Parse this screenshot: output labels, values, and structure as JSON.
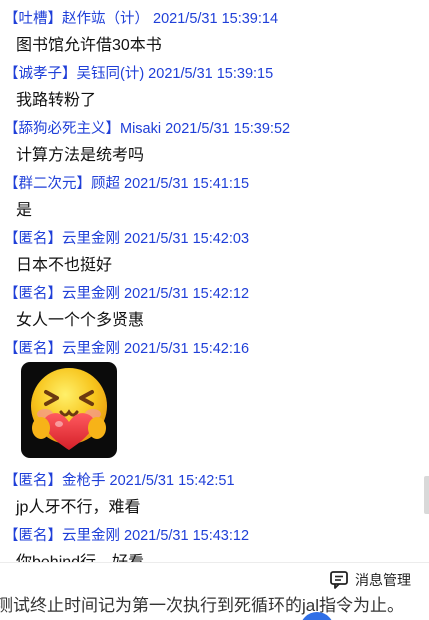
{
  "messages": [
    {
      "header": "【吐槽】赵作竑（计） 2021/5/31 15:39:14",
      "text": "图书馆允许借30本书"
    },
    {
      "header": "【诚孝子】吴钰同(计) 2021/5/31 15:39:15",
      "text": "我路转粉了"
    },
    {
      "header": "【舔狗必死主义】Misaki 2021/5/31 15:39:52",
      "text": "计算方法是统考吗"
    },
    {
      "header": "【群二次元】顾超 2021/5/31 15:41:15",
      "text": "是"
    },
    {
      "header": "【匿名】云里金刚 2021/5/31 15:42:03",
      "text": "日本不也挺好"
    },
    {
      "header": "【匿名】云里金刚 2021/5/31 15:42:12",
      "text": "女人一个个多贤惠"
    },
    {
      "header": "【匿名】云里金刚 2021/5/31 15:42:16",
      "sticker": "heart-hug-emoji"
    },
    {
      "header": "【匿名】金枪手 2021/5/31 15:42:51",
      "text": "jp人牙不行，难看"
    },
    {
      "header": "【匿名】云里金刚 2021/5/31 15:43:12",
      "text": "你behind行，好看"
    }
  ],
  "footer": {
    "manage_label": "消息管理",
    "manage_icon": "message-manage-icon"
  },
  "bottom_note": "测试终止时间记为第一次执行到死循环的jal指令为止。",
  "colors": {
    "header_blue": "#1f3fd8",
    "sticker_bg": "#0b0b0b",
    "emoji_yellow": "#f7c51d",
    "heart_red": "#e8282f"
  }
}
